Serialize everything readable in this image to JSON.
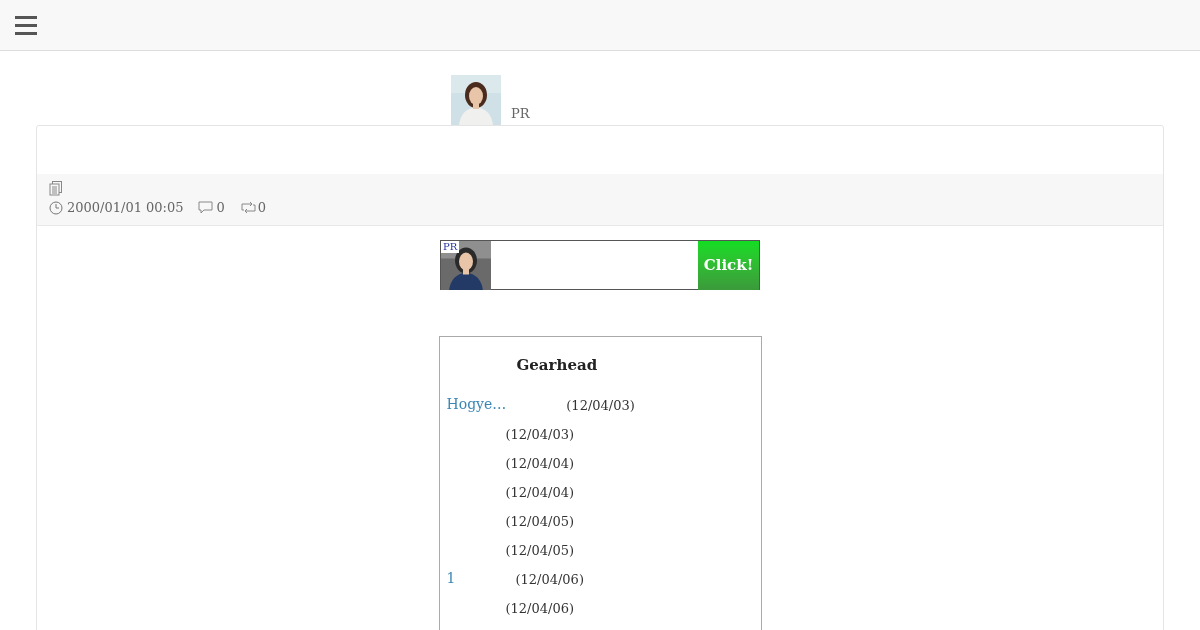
{
  "top_ad": {
    "label": "PR"
  },
  "post": {
    "meta": {
      "date": "2000/01/01 00:05",
      "comments": "0",
      "reblogs": "0"
    }
  },
  "banner": {
    "badge": "PR",
    "button": "Click!"
  },
  "widget": {
    "title": "Gearhead",
    "rows": [
      {
        "link": "Hogye…",
        "date": "(12/04/03)"
      },
      {
        "date": "(12/04/03)"
      },
      {
        "date": "(12/04/04)"
      },
      {
        "date": "(12/04/04)"
      },
      {
        "date": "(12/04/05)"
      },
      {
        "date": "(12/04/05)"
      },
      {
        "link": "1",
        "date": "(12/04/06)"
      },
      {
        "date": "(12/04/06)"
      }
    ]
  }
}
